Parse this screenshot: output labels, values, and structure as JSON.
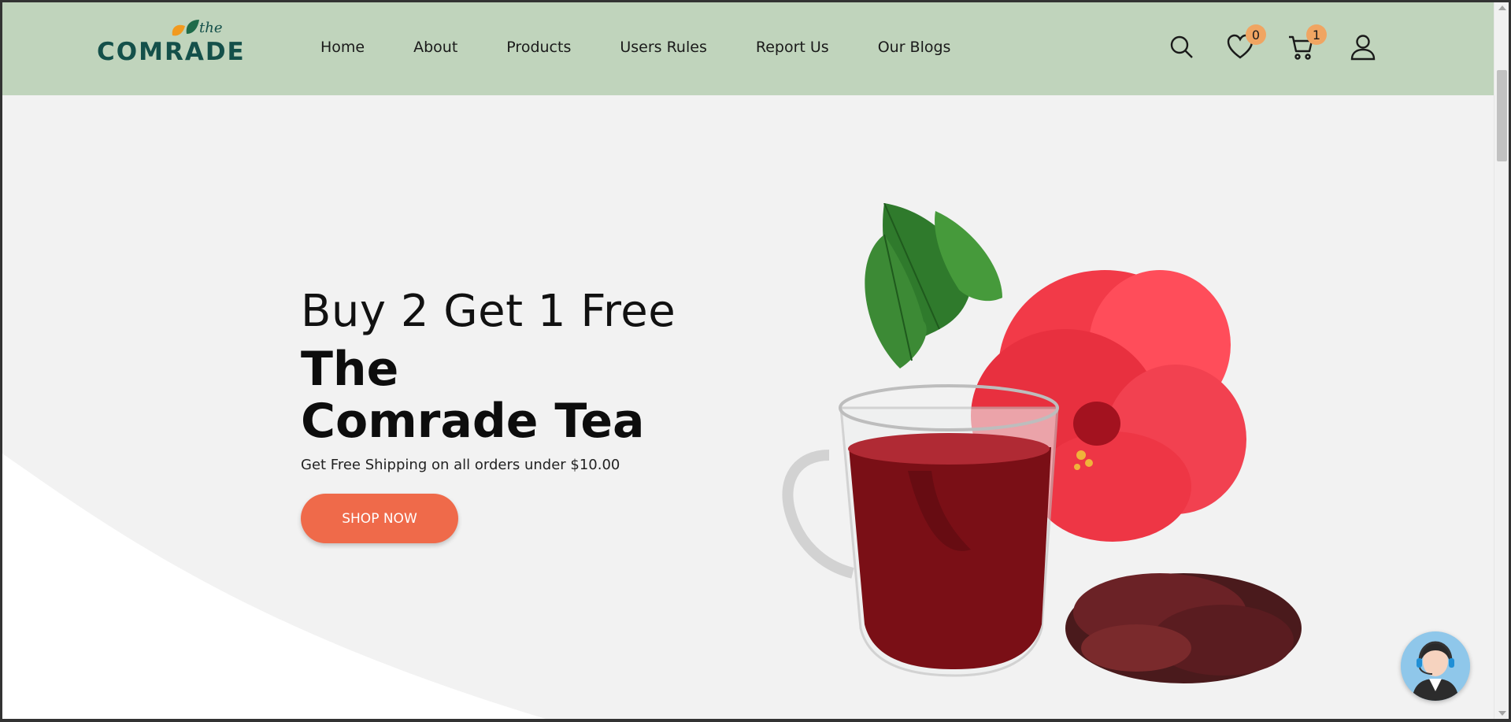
{
  "brand": {
    "the": "the",
    "name": "COMRADE"
  },
  "nav": {
    "items": [
      {
        "label": "Home"
      },
      {
        "label": "About"
      },
      {
        "label": "Products"
      },
      {
        "label": "Users Rules"
      },
      {
        "label": "Report Us"
      },
      {
        "label": "Our Blogs"
      }
    ]
  },
  "header_icons": {
    "search": "search-icon",
    "wishlist": {
      "icon": "heart-icon",
      "count": "0"
    },
    "cart": {
      "icon": "cart-icon",
      "count": "1"
    },
    "account": "user-icon"
  },
  "hero": {
    "promo": "Buy 2 Get 1 Free",
    "title_line1": "The",
    "title_line2": "Comrade Tea",
    "subtext": "Get Free Shipping on all orders under $10.00",
    "cta_label": "SHOP NOW"
  },
  "colors": {
    "header_bg": "#c0d4bc",
    "brand_green": "#14504a",
    "accent_orange": "#ef6a4a",
    "badge": "#f0a562"
  },
  "support": {
    "icon": "support-agent-icon"
  }
}
